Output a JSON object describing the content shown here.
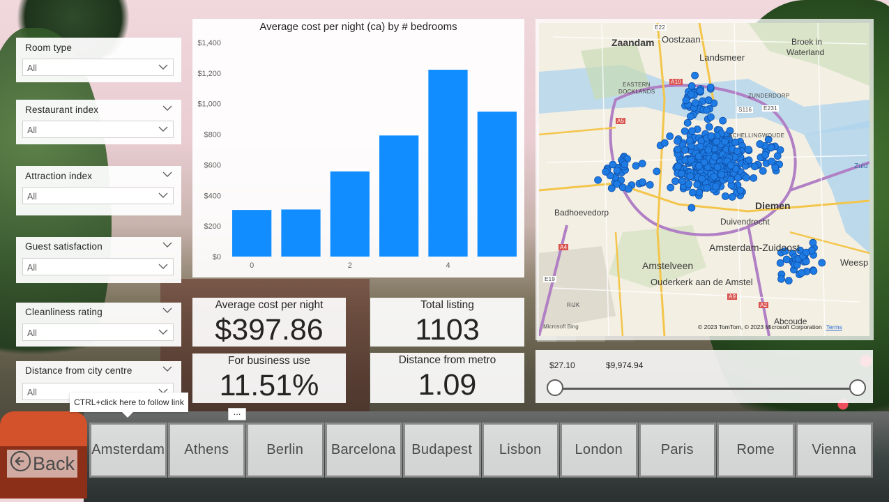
{
  "filters": [
    {
      "title": "Room type",
      "value": "All"
    },
    {
      "title": "Restaurant index",
      "value": "All"
    },
    {
      "title": "Attraction index",
      "value": "All"
    },
    {
      "title": "Guest satisfaction",
      "value": "All"
    },
    {
      "title": "Cleanliness rating",
      "value": "All"
    },
    {
      "title": "Distance from city centre",
      "value": "All"
    }
  ],
  "chart_data": {
    "type": "bar",
    "title": "Average cost per night (ca) by # bedrooms",
    "categories": [
      "0",
      "1",
      "2",
      "3",
      "4",
      "5"
    ],
    "x_tick_labels": [
      "0",
      "",
      "2",
      "",
      "4",
      ""
    ],
    "values": [
      305,
      308,
      557,
      792,
      1222,
      948
    ],
    "y_ticks": [
      "$0",
      "$200",
      "$400",
      "$600",
      "$800",
      "$1,000",
      "$1,200",
      "$1,400"
    ],
    "ylim": [
      0,
      1400
    ],
    "color": "#118dff",
    "grid": false
  },
  "kpis": {
    "avg_cost": {
      "label": "Average cost per night",
      "value": "$397.86"
    },
    "total_listing": {
      "label": "Total listing",
      "value": "1103"
    },
    "business": {
      "label": "For business use",
      "value": "11.51%"
    },
    "metro": {
      "label": "Distance from metro",
      "value": "1.09"
    }
  },
  "map": {
    "labels": {
      "zaandam": "Zaandam",
      "oostzaan": "Oostzaan",
      "landsmeer": "Landsmeer",
      "broek": "Broek in",
      "waterland": "Waterland",
      "eastern_docklands_1": "EASTERN",
      "eastern_docklands_2": "DOCKLANDS",
      "zunderdorp": "ZUNDERDORP",
      "schellingwoude": "SCHELLINGWOUDE",
      "badhoevedorp": "Badhoevedorp",
      "diemen": "Diemen",
      "duivendrecht": "Duivendrecht",
      "zuidoost": "Amsterdam-Zuidoost",
      "amstelveen": "Amstelveen",
      "ouderkerk": "Ouderkerk aan de Amstel",
      "weesp": "Weesp",
      "abcoude": "Abcoude",
      "zuid": "Zuid",
      "rijk": "RIJK",
      "e22": "E22",
      "a10": "A10",
      "a5": "A5",
      "a4": "A4",
      "a2": "A2",
      "a9": "A9",
      "e19": "E19",
      "e231": "E231",
      "s116": "S116"
    },
    "copyright": "© 2023 TomTom, © 2023 Microsoft Corporation",
    "terms": "Terms",
    "provider": "Microsoft Bing",
    "dot_color": "#1e7be3"
  },
  "price_range": {
    "min_label": "$27.10",
    "max_label": "$9,974.94",
    "low": 0.0,
    "high": 1.0
  },
  "tooltip": "CTRL+click here to follow link",
  "more_options": "...",
  "cities": [
    "Amsterdam",
    "Athens",
    "Berlin",
    "Barcelona",
    "Budapest",
    "Lisbon",
    "London",
    "Paris",
    "Rome",
    "Vienna"
  ],
  "back_label": "Back"
}
